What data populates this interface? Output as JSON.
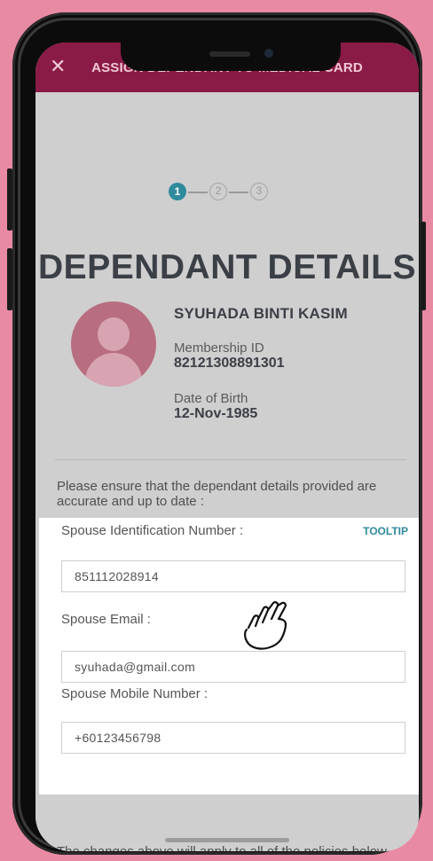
{
  "header": {
    "title": "ASSIGN DEPENDANT TO MEDICAL CARD",
    "close_symbol": "✕"
  },
  "stepper": {
    "steps": [
      "1",
      "2",
      "3"
    ],
    "current": 1
  },
  "page_title": "DEPENDANT DETAILS",
  "dependant": {
    "name": "SYUHADA BINTI KASIM",
    "membership_label": "Membership ID",
    "membership_id": "82121308891301",
    "dob_label": "Date of Birth",
    "dob": "12-Nov-1985"
  },
  "note": "Please ensure that the dependant details provided are accurate and up to date :",
  "form": {
    "id_label": "Spouse Identification Number :",
    "tooltip_label": "TOOLTIP",
    "id_value": "851112028914",
    "email_label": "Spouse Email :",
    "email_value": "syuhada@gmail.com",
    "mobile_label": "Spouse Mobile Number :",
    "mobile_value": "+60123456798"
  },
  "apply_note": "The changes above will apply to all of the policies below :",
  "colors": {
    "background": "#e98aa4",
    "header": "#8a1b46",
    "accent": "#2f8a9c",
    "avatar": "#b86d80"
  },
  "icons": {
    "close": "close-icon",
    "avatar": "avatar-icon",
    "pointer": "hand-pointer-icon"
  }
}
